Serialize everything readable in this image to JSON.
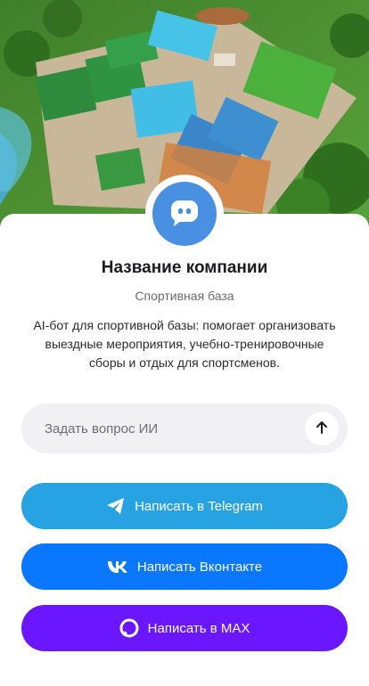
{
  "hero": {
    "alt": "sports-complex-illustration"
  },
  "company": {
    "name": "Название компании",
    "category": "Спортивная база",
    "description": "AI-бот для спортивной базы: помогает организовать выездные мероприятия, учебно-тренировочные сборы и отдых для спортсменов."
  },
  "ask": {
    "placeholder": "Задать вопрос ИИ",
    "send_icon": "arrow-up-icon"
  },
  "buttons": {
    "telegram": {
      "label": "Написать в Telegram",
      "icon": "telegram-icon",
      "color": "#27a3e3"
    },
    "vk": {
      "label": "Написать Вконтакте",
      "icon": "vk-icon",
      "color": "#0a77ff"
    },
    "max": {
      "label": "Написать в MAX",
      "icon": "max-icon",
      "color": "#6a16ff"
    }
  },
  "colors": {
    "avatar": "#4a90e2",
    "input_bg": "#f1f1f3"
  }
}
